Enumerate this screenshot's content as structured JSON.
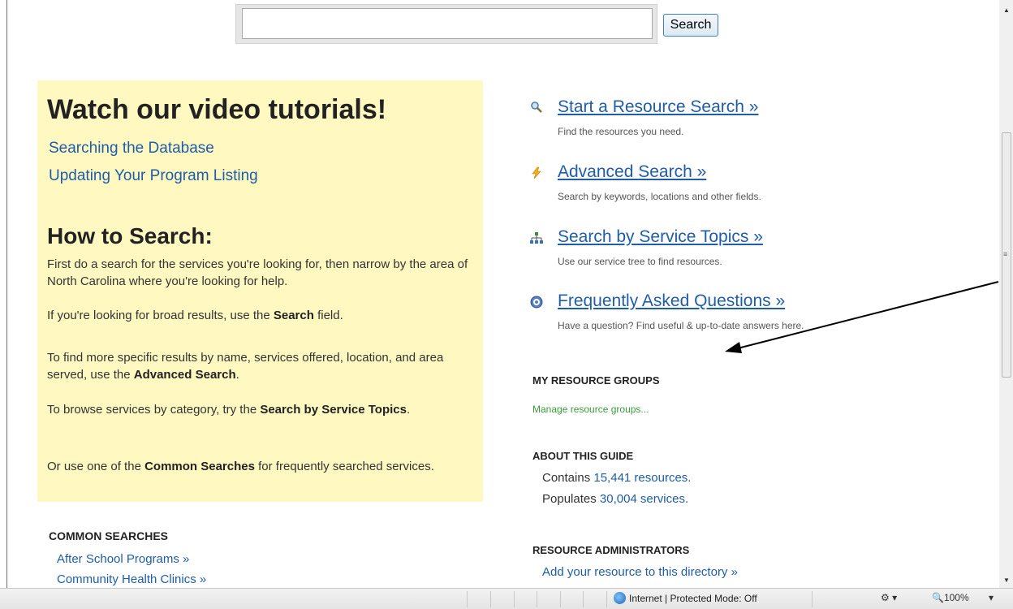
{
  "search": {
    "button_label": "Search",
    "placeholder": ""
  },
  "tutorials": {
    "title": "Watch our video tutorials!",
    "links": [
      "Searching the Database",
      "Updating Your Program Listing"
    ]
  },
  "howto": {
    "title": "How to Search:",
    "p1": "First do a search for the services you're looking for, then narrow by the area of North Carolina where you're looking for help.",
    "p2_pre": "If you're looking for broad results, use the ",
    "p2_bold": "Search",
    "p2_post": " field.",
    "p3_pre": "To find more specific results by name, services offered, location, and area served, use the ",
    "p3_bold": "Advanced Search",
    "p3_post": ".",
    "p4_pre": "To browse services by category, try the ",
    "p4_bold": "Search by Service Topics",
    "p4_post": ".",
    "p5_pre": "Or use one of the ",
    "p5_bold": "Common Searches",
    "p5_post": " for frequently searched services."
  },
  "common_searches": {
    "heading": "COMMON SEARCHES",
    "links": [
      "After School Programs »",
      "Community Health Clinics »"
    ]
  },
  "resources": [
    {
      "label": "Start a Resource Search »",
      "desc": "Find the resources you need.",
      "icon": "magnifier-icon"
    },
    {
      "label": "Advanced Search »",
      "desc": "Search by keywords, locations and other fields.",
      "icon": "lightning-icon"
    },
    {
      "label": "Search by Service Topics »",
      "desc": "Use our service tree to find resources.",
      "icon": "tree-icon"
    },
    {
      "label": "Frequently Asked Questions »",
      "desc": "Have a question? Find useful & up-to-date answers here.",
      "icon": "question-icon"
    }
  ],
  "my_groups": {
    "heading": "MY RESOURCE GROUPS",
    "manage": "Manage resource groups..."
  },
  "about": {
    "heading": "ABOUT THIS GUIDE",
    "line1_pre": "Contains ",
    "line1_num": "15,441 resources.",
    "line2_pre": "Populates ",
    "line2_num": "30,004 services."
  },
  "admins": {
    "heading": "RESOURCE ADMINISTRATORS",
    "link": "Add your resource to this directory »"
  },
  "statusbar": {
    "zone": "Internet | Protected Mode: Off",
    "zoom": "100%"
  },
  "colors": {
    "link": "#1f5da8",
    "panel": "#fff8c1",
    "manage": "#3b9b3b"
  }
}
